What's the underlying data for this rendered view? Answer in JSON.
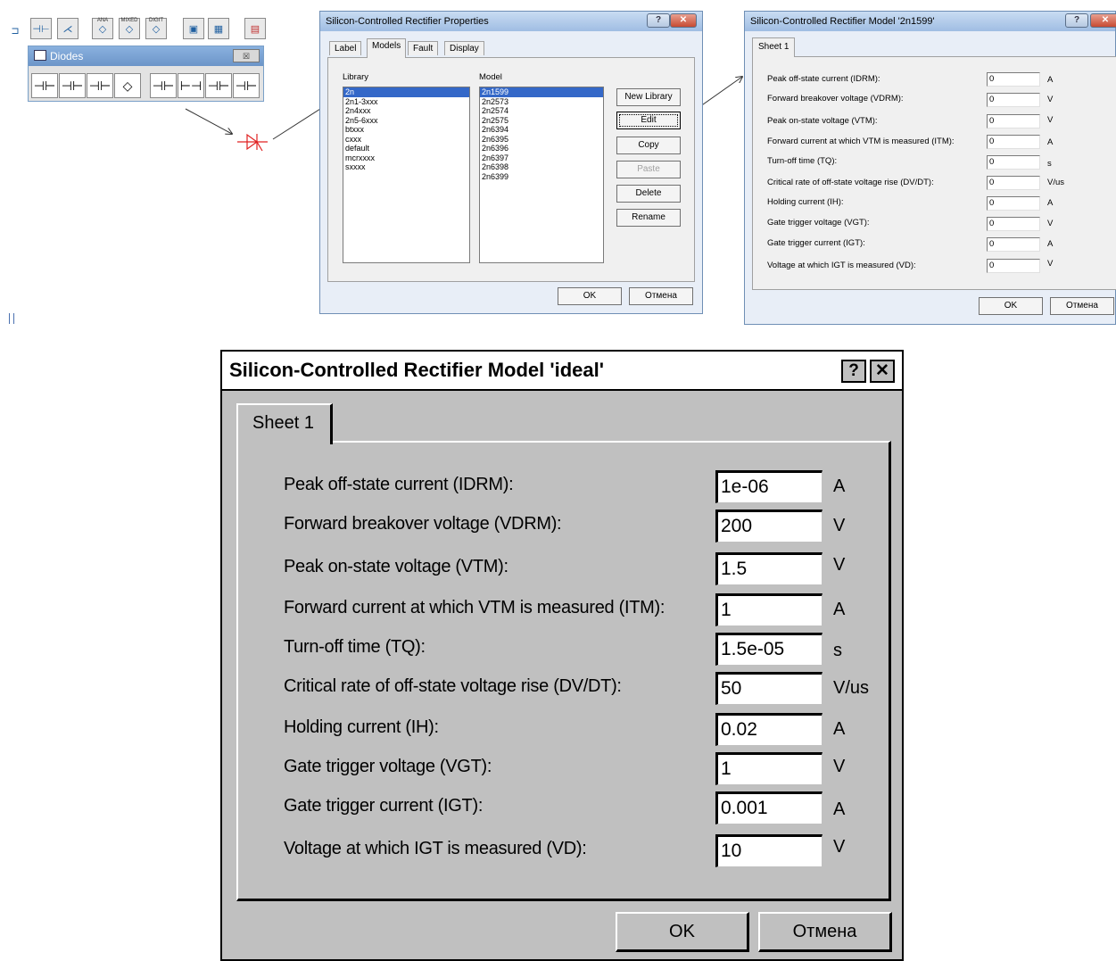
{
  "toolbar": {
    "labels": [
      "ANA",
      "MIXED",
      "DIGIT"
    ]
  },
  "diodes_palette": {
    "title": "Diodes",
    "close": "☒"
  },
  "properties_dialog": {
    "title": "Silicon-Controlled Rectifier Properties",
    "tabs": [
      "Label",
      "Models",
      "Fault",
      "Display"
    ],
    "library_label": "Library",
    "model_label": "Model",
    "libraries": [
      "2n",
      "2n1-3xxx",
      "2n4xxx",
      "2n5-6xxx",
      "btxxx",
      "cxxx",
      "default",
      "mcrxxxx",
      "sxxxx"
    ],
    "models": [
      "2n1599",
      "2n2573",
      "2n2574",
      "2n2575",
      "2n6394",
      "2n6395",
      "2n6396",
      "2n6397",
      "2n6398",
      "2n6399"
    ],
    "buttons": {
      "new_library": "New Library",
      "edit": "Edit",
      "copy": "Copy",
      "paste": "Paste",
      "delete": "Delete",
      "rename": "Rename",
      "ok": "OK",
      "cancel": "Отмена"
    }
  },
  "model_dialog_small": {
    "title": "Silicon-Controlled Rectifier Model '2n1599'",
    "tab": "Sheet 1",
    "params": [
      {
        "label": "Peak off-state current (IDRM):",
        "value": "0",
        "unit": "A"
      },
      {
        "label": "Forward breakover voltage (VDRM):",
        "value": "0",
        "unit": "V"
      },
      {
        "label": "Peak on-state voltage (VTM):",
        "value": "0",
        "unit": "V"
      },
      {
        "label": "Forward current at which VTM is measured (ITM):",
        "value": "0",
        "unit": "A"
      },
      {
        "label": "Turn-off time (TQ):",
        "value": "0",
        "unit": "s"
      },
      {
        "label": "Critical rate of off-state voltage rise (DV/DT):",
        "value": "0",
        "unit": "V/us"
      },
      {
        "label": "Holding current (IH):",
        "value": "0",
        "unit": "A"
      },
      {
        "label": "Gate trigger voltage (VGT):",
        "value": "0",
        "unit": "V"
      },
      {
        "label": "Gate trigger current (IGT):",
        "value": "0",
        "unit": "A"
      },
      {
        "label": "Voltage at which IGT is measured (VD):",
        "value": "0",
        "unit": "V"
      }
    ],
    "ok": "OK",
    "cancel": "Отмена"
  },
  "model_dialog_ideal": {
    "title": "Silicon-Controlled Rectifier Model 'ideal'",
    "help": "?",
    "close": "✕",
    "tab": "Sheet 1",
    "params": [
      {
        "label": "Peak off-state current (IDRM):",
        "value": "1e-06",
        "unit": "A"
      },
      {
        "label": "Forward breakover voltage (VDRM):",
        "value": "200",
        "unit": "V"
      },
      {
        "label": "Peak on-state voltage (VTM):",
        "value": "1.5",
        "unit": "V"
      },
      {
        "label": "Forward current at which VTM is measured (ITM):",
        "value": "1",
        "unit": "A"
      },
      {
        "label": "Turn-off time (TQ):",
        "value": "1.5e-05",
        "unit": "s"
      },
      {
        "label": "Critical rate of off-state voltage rise (DV/DT):",
        "value": "50",
        "unit": "V/us"
      },
      {
        "label": "Holding current (IH):",
        "value": "0.02",
        "unit": "A"
      },
      {
        "label": "Gate trigger voltage (VGT):",
        "value": "1",
        "unit": "V"
      },
      {
        "label": "Gate trigger current (IGT):",
        "value": "0.001",
        "unit": "A"
      },
      {
        "label": "Voltage at which IGT is measured (VD):",
        "value": "10",
        "unit": "V"
      }
    ],
    "ok": "OK",
    "cancel": "Отмена"
  },
  "colors": {
    "selection": "#3468c8",
    "symbol": "#e02020",
    "arrow": "#333333",
    "titlebar": "#9fbde3"
  }
}
